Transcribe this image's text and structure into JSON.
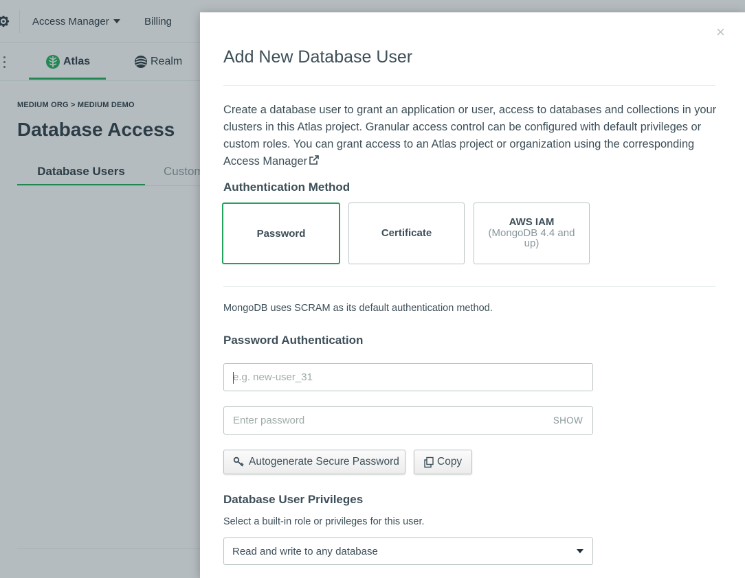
{
  "background": {
    "topbar": {
      "access_manager": "Access Manager",
      "billing": "Billing"
    },
    "nav": {
      "atlas": "Atlas",
      "realm": "Realm"
    },
    "breadcrumb": "MEDIUM ORG > MEDIUM DEMO",
    "page_title": "Database Access",
    "tabs": [
      "Database Users",
      "Custom"
    ],
    "accent": "#13aa52"
  },
  "modal": {
    "title": "Add New Database User",
    "close": "×",
    "intro": "Create a database user to grant an application or user, access to databases and collections in your clusters in this Atlas project. Granular access control can be configured with default privileges or custom roles. You can grant access to an Atlas project or organization using the corresponding",
    "intro_link": "Access Manager",
    "auth": {
      "title": "Authentication Method",
      "options": [
        {
          "label": "Password",
          "selected": true
        },
        {
          "label": "Certificate",
          "selected": false
        },
        {
          "label": "AWS IAM",
          "sub": "(MongoDB 4.4 and up)",
          "selected": false
        }
      ],
      "scram_pre": "MongoDB uses",
      "scram_link": "SCRAM",
      "scram_post": "as its default authentication method."
    },
    "password_auth": {
      "title": "Password Authentication",
      "username_placeholder": "e.g. new-user_31",
      "password_placeholder": "Enter password",
      "show_label": "SHOW",
      "autogen_label": "Autogenerate Secure Password",
      "copy_label": "Copy"
    },
    "privileges": {
      "title": "Database User Privileges",
      "subtitle": "Select a built-in role or privileges for this user.",
      "selected_role": "Read and write to any database"
    },
    "selected_border": "#21a25d"
  }
}
